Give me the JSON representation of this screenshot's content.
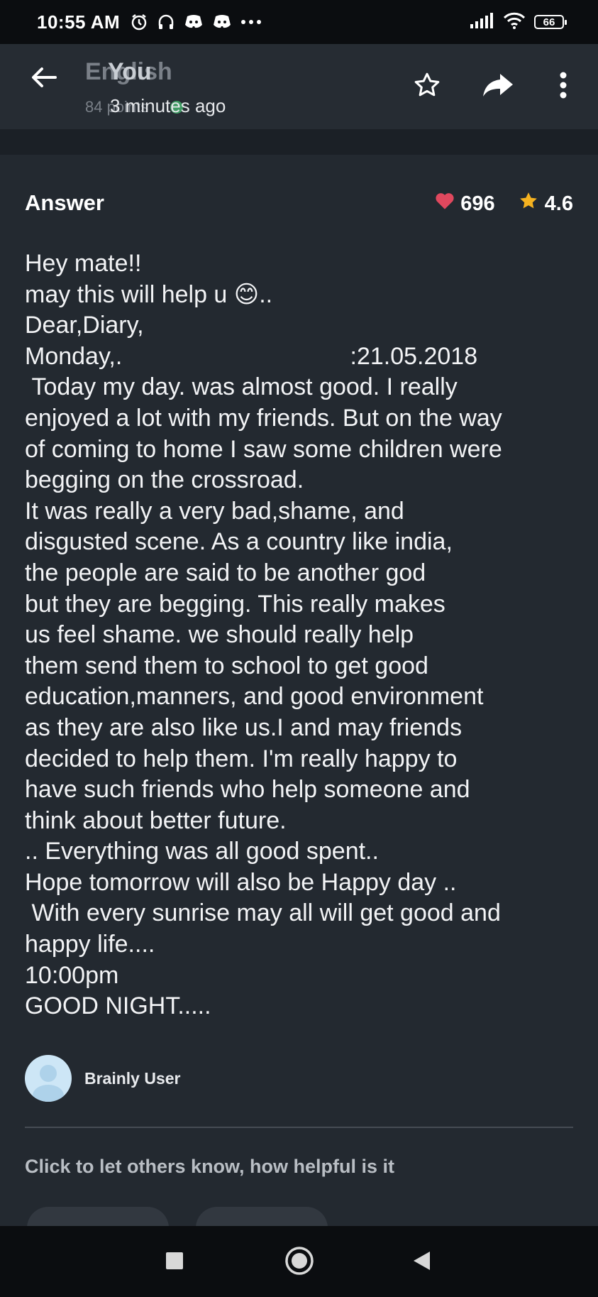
{
  "status_bar": {
    "time": "10:55 AM",
    "icons": [
      "alarm-icon",
      "headphones-icon",
      "discord-icon",
      "discord-icon",
      "more-dots-icon"
    ],
    "battery": "66",
    "right_icons": [
      "signal-icon",
      "wifi-icon",
      "battery-icon"
    ]
  },
  "header": {
    "ghost_title": "English",
    "title": "You",
    "ghost_subtitle": "84 points",
    "subtitle": "3 minutes ago",
    "icons": [
      "back-arrow-icon",
      "star-outline-icon",
      "share-icon",
      "more-vertical-icon"
    ]
  },
  "answer": {
    "heading": "Answer",
    "likes": "696",
    "rating": "4.6",
    "like_color": "#e0485e",
    "star_color": "#f5b220",
    "lines": [
      "Hey mate!!",
      "may this will help u 😊..",
      "Dear,Diary,",
      "Monday,.                                  :21.05.2018",
      " Today my day. was almost good. I really",
      "enjoyed a lot with my friends. But on the way",
      "of coming to home I saw some children were",
      "begging on the crossroad.",
      "It was really a very bad,shame, and",
      "disgusted scene. As a country like india,",
      "the people are said to be another god",
      "but they are begging. This really makes",
      "us feel shame. we should really help",
      "them send them to school to get good",
      "education,manners, and good environment",
      "as they are also like us.I and may friends",
      "decided to help them. I'm really happy to",
      "have such friends who help someone and",
      "think about better future.",
      ".. Everything was all good spent..",
      "Hope tomorrow will also be Happy day ..",
      " With every sunrise may all will get good and",
      "happy life....",
      "10:00pm",
      "GOOD NIGHT....."
    ]
  },
  "author": {
    "name": "Brainly User"
  },
  "helpful_prompt": "Click to let others know, how helpful is it",
  "nav": {
    "icons": [
      "recents-square-icon",
      "home-circle-icon",
      "back-triangle-icon"
    ]
  }
}
